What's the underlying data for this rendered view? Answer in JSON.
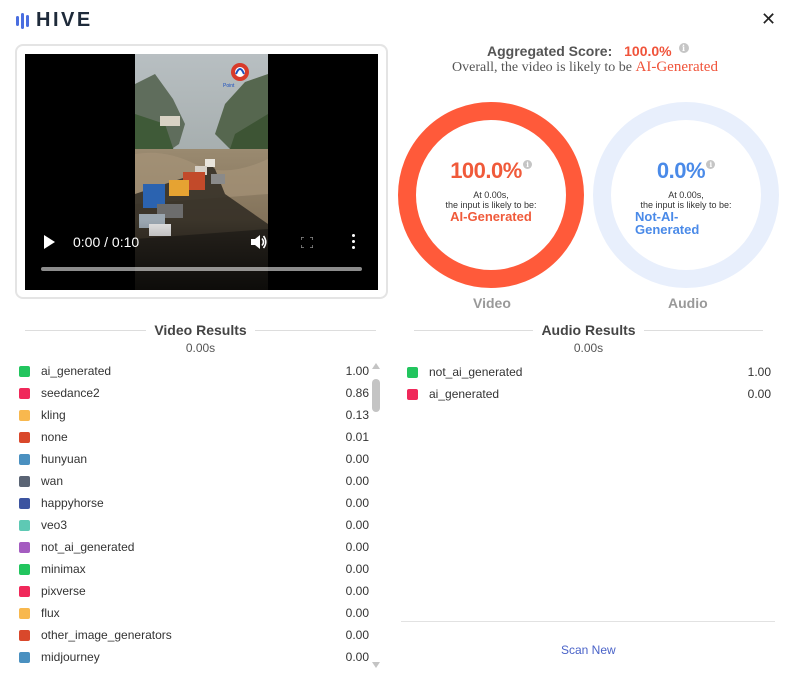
{
  "app": {
    "name": "HIVE"
  },
  "video": {
    "time_display": "0:00 / 0:10",
    "progress": 0.0,
    "watermark_text": "Point"
  },
  "aggregate": {
    "label": "Aggregated Score:",
    "score": "100.0%",
    "overall_prefix": "Overall, the video is likely to be",
    "overall_label": "AI-Generated"
  },
  "video_score": {
    "pct": "100.0%",
    "at_time": "At 0.00s,",
    "likely_text": "the input is likely to be:",
    "label": "AI-Generated",
    "caption": "Video"
  },
  "audio_score": {
    "pct": "0.0%",
    "at_time": "At 0.00s,",
    "likely_text": "the input is likely to be:",
    "label": "Not-AI-Generated",
    "caption": "Audio"
  },
  "video_results": {
    "title": "Video Results",
    "time": "0.00s",
    "items": [
      {
        "label": "ai_generated",
        "value": "1.00",
        "color": "#22c55e"
      },
      {
        "label": "seedance2",
        "value": "0.86",
        "color": "#f0285a"
      },
      {
        "label": "kling",
        "value": "0.13",
        "color": "#f8b84e"
      },
      {
        "label": "none",
        "value": "0.01",
        "color": "#d9482b"
      },
      {
        "label": "hunyuan",
        "value": "0.00",
        "color": "#4a90c0"
      },
      {
        "label": "wan",
        "value": "0.00",
        "color": "#5a6474"
      },
      {
        "label": "happyhorse",
        "value": "0.00",
        "color": "#3c54a0"
      },
      {
        "label": "veo3",
        "value": "0.00",
        "color": "#5ec9b4"
      },
      {
        "label": "not_ai_generated",
        "value": "0.00",
        "color": "#a45cc0"
      },
      {
        "label": "minimax",
        "value": "0.00",
        "color": "#22c55e"
      },
      {
        "label": "pixverse",
        "value": "0.00",
        "color": "#f0285a"
      },
      {
        "label": "flux",
        "value": "0.00",
        "color": "#f8b84e"
      },
      {
        "label": "other_image_generators",
        "value": "0.00",
        "color": "#d9482b"
      },
      {
        "label": "midjourney",
        "value": "0.00",
        "color": "#4a90c0"
      }
    ]
  },
  "audio_results": {
    "title": "Audio Results",
    "time": "0.00s",
    "items": [
      {
        "label": "not_ai_generated",
        "value": "1.00",
        "color": "#22c55e"
      },
      {
        "label": "ai_generated",
        "value": "0.00",
        "color": "#f0285a"
      }
    ]
  },
  "actions": {
    "scan_new": "Scan New"
  },
  "icons": {
    "close": "close-icon",
    "info": "info-icon",
    "play": "play-icon",
    "volume": "volume-icon",
    "fullscreen": "fullscreen-icon",
    "more": "more-vertical-icon"
  }
}
